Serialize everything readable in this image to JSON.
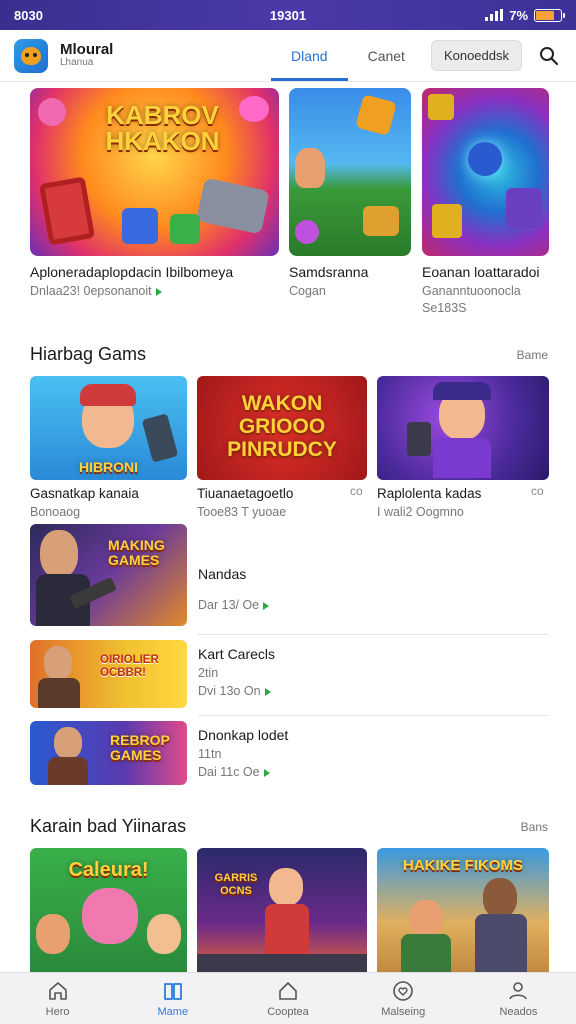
{
  "status": {
    "time_left": "8030",
    "time_center": "19301",
    "battery": "7%",
    "battery_level": 0.75
  },
  "header": {
    "app_name": "Mloural",
    "app_sub": "Lhanua",
    "tabs": [
      "Dland",
      "Canet"
    ],
    "active_tab": 0,
    "pill": "Konoeddsk"
  },
  "featured": [
    {
      "title": "Aploneradaplopdacin Ibilbomeya",
      "sub": "Dnlaa23! 0epsonanoit",
      "image_text": "KABROV HKAKON"
    },
    {
      "title": "Samdsranna",
      "sub": "Cogan"
    },
    {
      "title": "Eoanan loattaradoi",
      "sub": "Gananntuoonocla",
      "sub2": "Se183S"
    }
  ],
  "section1": {
    "title": "Hiarbag Gams",
    "more": "Bame"
  },
  "grid": [
    {
      "title": "Gasnatkap kanaia",
      "sub": "Bonoaog",
      "image_text": "HIBRONI"
    },
    {
      "title": "Tiuanaetagoetlo",
      "sub": "Tooe83 T yuoae",
      "more": "co",
      "image_text": "WAKON GRIOOO PINRUDCY"
    },
    {
      "title": "Raplolenta kadas",
      "sub": "I wali2 Oogmno",
      "more": "co"
    }
  ],
  "list": [
    {
      "title": "Nandas",
      "line1": "Dar 13/ Oe",
      "image_text": "MAKING GAMES"
    },
    {
      "title": "Kart Carecls",
      "line1": "2tin",
      "line2": "Dvi 13o On",
      "image_text": "OIRIOLIER OCBBR!"
    },
    {
      "title": "Dnonkap lodet",
      "line1": "11tn",
      "line2": "Dai 11c Oe",
      "image_text": "REBROP GAMES"
    }
  ],
  "section2": {
    "title": "Karain bad Yiinaras",
    "more": "Bans"
  },
  "bottom_cards": [
    {
      "image_text": "Caleura!"
    },
    {
      "image_text": "GARRIS OCNS"
    },
    {
      "image_text": "HAKIKE FIKOMS"
    }
  ],
  "nav": [
    {
      "label": "Hero",
      "icon": "home-icon"
    },
    {
      "label": "Mame",
      "icon": "book-icon"
    },
    {
      "label": "Cooptea",
      "icon": "house-icon"
    },
    {
      "label": "Malseing",
      "icon": "heart-icon"
    },
    {
      "label": "Neados",
      "icon": "user-icon"
    }
  ],
  "nav_active": 1,
  "colors": {
    "accent": "#2a6fd6",
    "status_bar": "#3a2f8f",
    "play_dot": "#31a846"
  }
}
